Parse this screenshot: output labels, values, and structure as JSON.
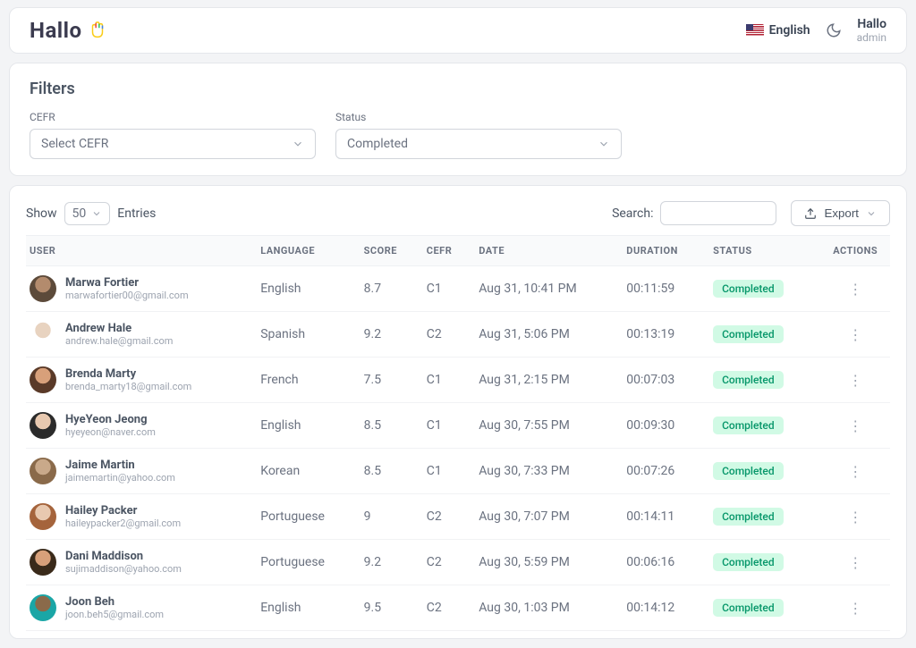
{
  "header": {
    "logo_text": "Hallo",
    "language_label": "English",
    "user_name": "Hallo",
    "user_role": "admin"
  },
  "filters": {
    "title": "Filters",
    "cefr_label": "CEFR",
    "cefr_placeholder": "Select CEFR",
    "status_label": "Status",
    "status_value": "Completed"
  },
  "table": {
    "show_label": "Show",
    "entries_value": "50",
    "entries_label": "Entries",
    "search_label": "Search:",
    "export_label": "Export",
    "columns": {
      "user": "USER",
      "language": "LANGUAGE",
      "score": "SCORE",
      "cefr": "CEFR",
      "date": "DATE",
      "duration": "DURATION",
      "status": "STATUS",
      "actions": "ACTIONS"
    },
    "rows": [
      {
        "name": "Marwa Fortier",
        "email": "marwafortier00@gmail.com",
        "language": "English",
        "score": "8.7",
        "cefr": "C1",
        "date": "Aug 31, 10:41 PM",
        "duration": "00:11:59",
        "status": "Completed"
      },
      {
        "name": "Andrew Hale",
        "email": "andrew.hale@gmail.com",
        "language": "Spanish",
        "score": "9.2",
        "cefr": "C2",
        "date": "Aug 31, 5:06 PM",
        "duration": "00:13:19",
        "status": "Completed"
      },
      {
        "name": "Brenda Marty",
        "email": "brenda_marty18@gmail.com",
        "language": "French",
        "score": "7.5",
        "cefr": "C1",
        "date": "Aug 31, 2:15 PM",
        "duration": "00:07:03",
        "status": "Completed"
      },
      {
        "name": "HyeYeon Jeong",
        "email": "hyeyeon@naver.com",
        "language": "English",
        "score": "8.5",
        "cefr": "C1",
        "date": "Aug 30, 7:55 PM",
        "duration": "00:09:30",
        "status": "Completed"
      },
      {
        "name": "Jaime Martin",
        "email": "jaimemartin@yahoo.com",
        "language": "Korean",
        "score": "8.5",
        "cefr": "C1",
        "date": "Aug 30, 7:33 PM",
        "duration": "00:07:26",
        "status": "Completed"
      },
      {
        "name": "Hailey Packer",
        "email": "haileypacker2@gmail.com",
        "language": "Portuguese",
        "score": "9",
        "cefr": "C2",
        "date": "Aug 30, 7:07 PM",
        "duration": "00:14:11",
        "status": "Completed"
      },
      {
        "name": "Dani Maddison",
        "email": "sujimaddison@yahoo.com",
        "language": "Portuguese",
        "score": "9.2",
        "cefr": "C2",
        "date": "Aug 30, 5:59 PM",
        "duration": "00:06:16",
        "status": "Completed"
      },
      {
        "name": "Joon Beh",
        "email": "joon.beh5@gmail.com",
        "language": "English",
        "score": "9.5",
        "cefr": "C2",
        "date": "Aug 30, 1:03 PM",
        "duration": "00:14:12",
        "status": "Completed"
      }
    ]
  }
}
